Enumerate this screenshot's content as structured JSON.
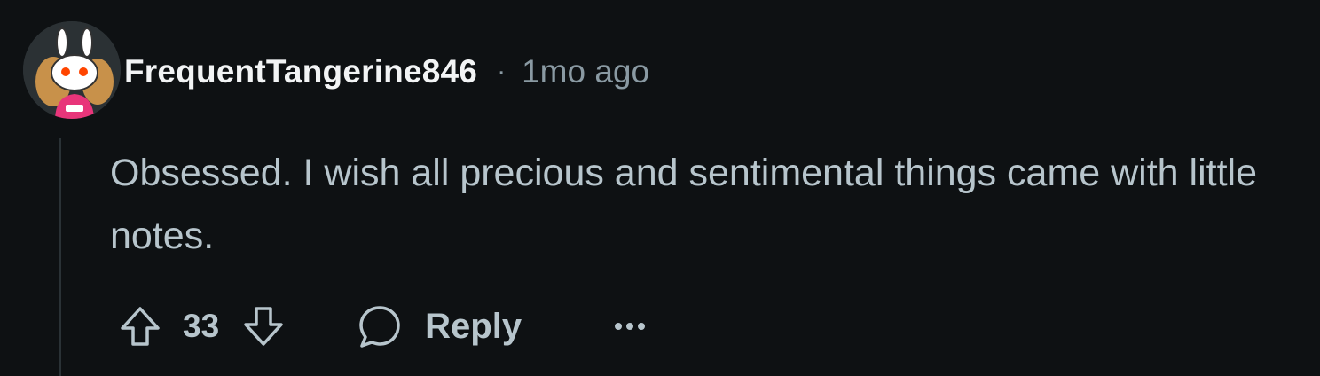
{
  "comment": {
    "username": "FrequentTangerine846",
    "separator": "·",
    "timestamp": "1mo ago",
    "text": "Obsessed. I wish all precious and sentimental things came with little notes.",
    "vote_count": "33",
    "reply_label": "Reply"
  },
  "icons": {
    "avatar": "bunny-snoo-avatar",
    "upvote": "upvote-arrow-icon",
    "downvote": "downvote-arrow-icon",
    "reply": "speech-bubble-icon",
    "more": "more-options-icon"
  },
  "colors": {
    "background": "#0e1113",
    "username": "#f2f4f5",
    "meta": "#8a9aa3",
    "body_text": "#b7c5cc",
    "thread_line": "#2a3236"
  }
}
